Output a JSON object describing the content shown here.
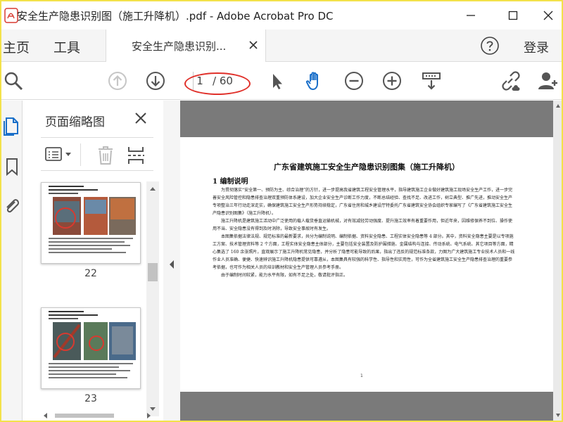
{
  "window": {
    "title": "安全生产隐患识别图（施工升降机）.pdf - Adobe Acrobat Pro DC"
  },
  "menu": {
    "home": "主页",
    "tools": "工具",
    "tab_label": "安全生产隐患识别...",
    "login": "登录"
  },
  "toolbar": {
    "current_page": "1",
    "total_pages": "/ 60"
  },
  "thumbnails": {
    "title": "页面缩略图",
    "pages": [
      {
        "number": "22"
      },
      {
        "number": "23"
      }
    ]
  },
  "document": {
    "title": "广东省建筑施工安全生产隐患识别图集（施工升降机）",
    "heading": "1 编制说明",
    "paragraphs": [
      "为贯彻落实“安全第一、预防为主、综合治理”的方针，进一步提高我省建筑工程安全管理水平，指导建筑施工企业做好建筑施工现场安全生产工作，进一步完善安全风险管控和隐患排查治理双重预防体系建设，加大企业安全生产诊断工作力度，不断总结经验、查找不足、改进工作，树立典型、推广先进，推动安全生产专项整治三年行动走深走实，确保建筑施工安全生产形势持续稳定，广东省住房和城乡建设厅特委托广东省建筑安全协会组织专家编写了《广东省建筑施工安全生产隐患识别图集》（施工升降机）。",
      "施工升降机是建筑施工活动中广泛使用的载人载货垂直运输机械，对有效减轻劳动强度、提升施工效率有着重要作用，但近年来，因维修保养不到位、操作使用不当、安全隐患没有得到及时消除，导致安全事故时有发生。",
      "本图集依据法律法规、规范标准的最新要求，共分为编制说明、编制依据、资料安全隐患、工程实体安全隐患等 4 部分。其中，资料安全隐患主要是以专项施工方案、技术管理资料等 2 个方面，工程实体安全隐患主体部分，主要包括安全装置及防护围措施、金属结构与连接、传动系统、电气系统、其它项目等方面，精心集选了 160 余张照片，直观展示了施工升降机常见隐患，并分析了隐患可能导致的后果，指出了违反的规范标准条款，力图为广大建筑施工专业技术人员和一线作业人员准确、便捷、快速辨识施工升降机隐患提供可靠遵从，本图集具有较强的科学性、指导性和实用性，可作为全省建筑施工安全生产隐患排查治理的重要参考依据，也可作为相关人员的培训教材和安全生产管理人员参考手册。",
      "由于编制时间较紧，能力水平有限，如有不足之处，敬请批评指正。"
    ],
    "page_number": "1"
  },
  "colors": {
    "accent_blue": "#1a6fc9",
    "annotation_red": "#e0302a",
    "doc_background": "#7a7a7a",
    "frame_yellow": "#f3e24a"
  }
}
